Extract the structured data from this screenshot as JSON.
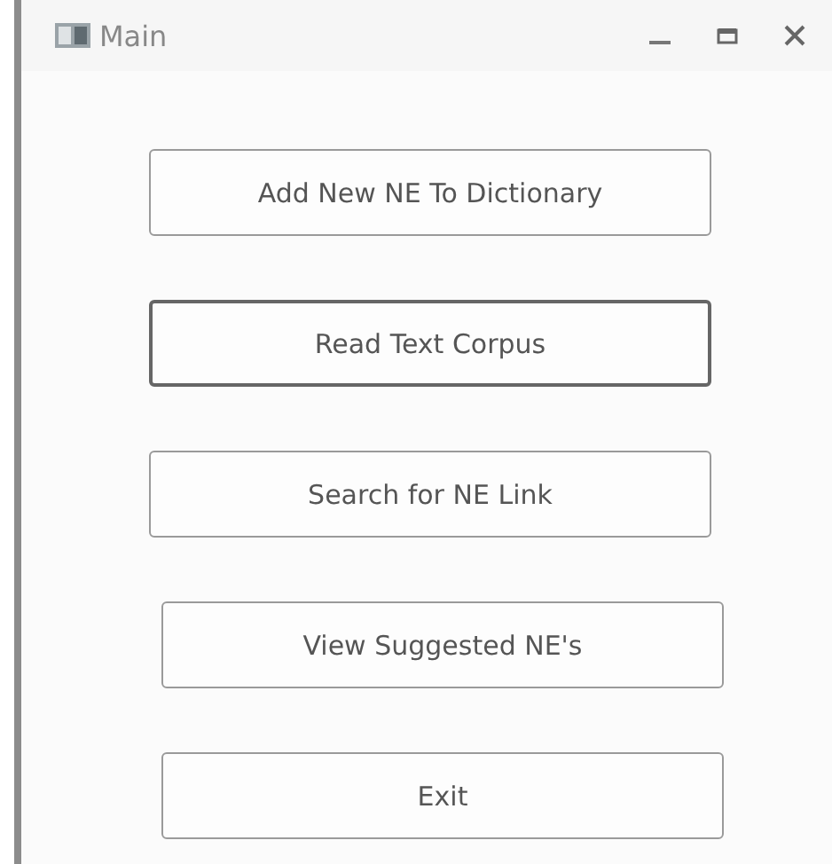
{
  "window": {
    "title": "Main"
  },
  "buttons": [
    {
      "label": "Add New NE To Dictionary",
      "focused": false
    },
    {
      "label": "Read Text Corpus",
      "focused": true
    },
    {
      "label": "Search for NE Link",
      "focused": false
    },
    {
      "label": "View Suggested NE's",
      "focused": false
    },
    {
      "label": "Exit",
      "focused": false
    }
  ]
}
